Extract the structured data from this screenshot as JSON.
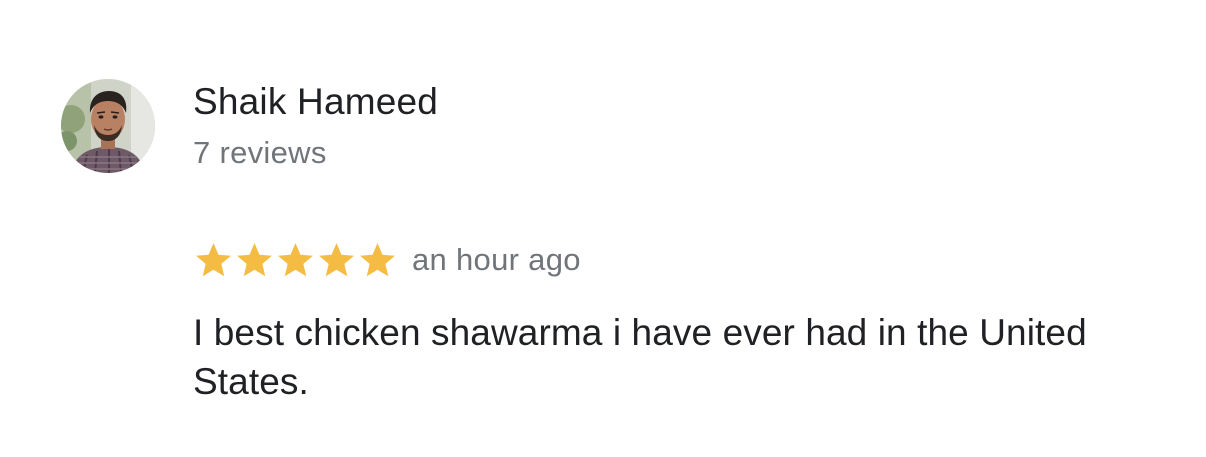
{
  "review": {
    "reviewer_name": "Shaik Hameed",
    "reviewer_reviews": "7 reviews",
    "rating": 5,
    "rating_max": 5,
    "star_color": "#f4bc42",
    "time": "an hour ago",
    "text": "I best chicken shawarma i have ever had in the United States."
  }
}
